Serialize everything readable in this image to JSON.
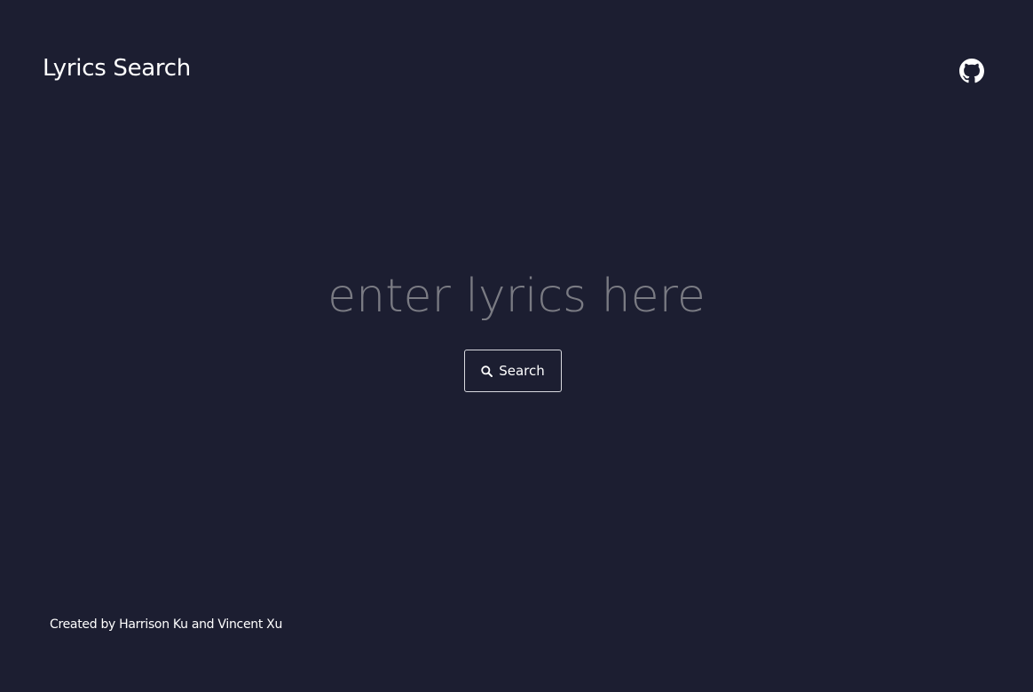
{
  "header": {
    "title": "Lyrics Search",
    "github_icon": "github-icon"
  },
  "search": {
    "placeholder": "enter lyrics here",
    "value": "",
    "button_label": "Search",
    "button_icon": "search-icon"
  },
  "footer": {
    "credit": "Created by Harrison Ku and Vincent Xu"
  },
  "colors": {
    "background": "#1c1e31",
    "text": "#ffffff",
    "placeholder": "#7a7b83",
    "button_border": "#d9dae0"
  }
}
